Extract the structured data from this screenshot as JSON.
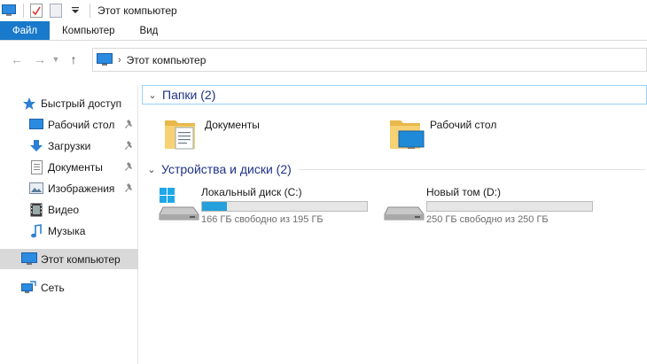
{
  "window": {
    "title": "Этот компьютер"
  },
  "ribbon": {
    "tabs": [
      "Файл",
      "Компьютер",
      "Вид"
    ]
  },
  "address": {
    "path": "Этот компьютер"
  },
  "nav": {
    "quick_access": "Быстрый доступ",
    "items": [
      {
        "label": "Рабочий стол",
        "icon": "desktop-icon",
        "pinned": true
      },
      {
        "label": "Загрузки",
        "icon": "downloads-icon",
        "pinned": true
      },
      {
        "label": "Документы",
        "icon": "documents-icon",
        "pinned": true
      },
      {
        "label": "Изображения",
        "icon": "pictures-icon",
        "pinned": true
      },
      {
        "label": "Видео",
        "icon": "videos-icon",
        "pinned": false
      },
      {
        "label": "Музыка",
        "icon": "music-icon",
        "pinned": false
      }
    ],
    "this_pc": "Этот компьютер",
    "network": "Сеть"
  },
  "folders": {
    "heading": "Папки (2)",
    "items": [
      {
        "name": "Документы"
      },
      {
        "name": "Рабочий стол"
      }
    ]
  },
  "drives": {
    "heading": "Устройства и диски (2)",
    "items": [
      {
        "name": "Локальный диск (C:)",
        "free_text": "166 ГБ свободно из 195 ГБ",
        "used_fraction": 0.149
      },
      {
        "name": "Новый том (D:)",
        "free_text": "250 ГБ свободно из 250 ГБ",
        "used_fraction": 0.0
      }
    ]
  },
  "colors": {
    "accent": "#1979ca",
    "section_title": "#1e3287",
    "bar_fill": "#26a0da"
  }
}
